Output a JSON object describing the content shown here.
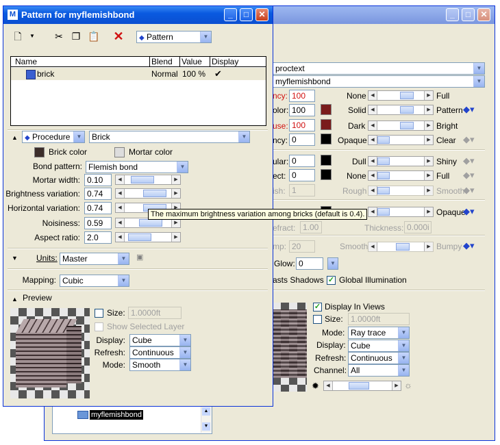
{
  "main_window": {
    "row_proctext": "proctext",
    "row_name": "myflemishbond",
    "rows": [
      {
        "label": "ncy:",
        "value": "100",
        "left": "None",
        "right": "Full"
      },
      {
        "label": "olor:",
        "value": "100",
        "left": "Solid",
        "right": "Pattern"
      },
      {
        "label": "use:",
        "value": "100",
        "left": "Dark",
        "right": "Bright"
      },
      {
        "label": "ncy:",
        "value": "0",
        "left": "Opaque",
        "right": "Clear"
      },
      {
        "label": "ular:",
        "value": "0",
        "left": "Dull",
        "right": "Shiny"
      },
      {
        "label": "ect:",
        "value": "0",
        "left": "None",
        "right": "Full"
      },
      {
        "label": "ish:",
        "value": "1",
        "left": "Rough",
        "right": "Smooth"
      },
      {
        "label": "",
        "value": "",
        "left": "",
        "right": "Opaque"
      }
    ],
    "refract_label": "efract:",
    "refract_value": "1.00",
    "thickness_label": "Thickness:",
    "thickness_value": "0.000i",
    "bump_label": "mp:",
    "bump_value": "20",
    "bump_left": "Smooth",
    "bump_right": "Bumpy",
    "glow_label": "Glow:",
    "glow_value": "0",
    "casts_shadows": "asts Shadows",
    "global_illumination": "Global Illumination",
    "display_in_views": "Display In Views",
    "size_label": "Size:",
    "size_value": "1.0000ft",
    "mode_label": "Mode:",
    "mode_value": "Ray trace",
    "display_label": "Display:",
    "display_value": "Cube",
    "refresh_label": "Refresh:",
    "refresh_value": "Continuous",
    "channel_label": "Channel:",
    "channel_value": "All",
    "tree_item": "myflemishbond"
  },
  "pattern_window": {
    "title": "Pattern for myflemishbond",
    "toolbar_dropdown": "Pattern",
    "table": {
      "headers": [
        "Name",
        "Blend",
        "Value",
        "Display"
      ],
      "rows": [
        {
          "name": "brick",
          "blend": "Normal",
          "value": "100 %",
          "display": "✔"
        }
      ]
    },
    "procedure_dropdown": "Procedure",
    "brick_dropdown": "Brick",
    "brick_color": "Brick color",
    "mortar_color": "Mortar color",
    "bond_pattern_label": "Bond pattern:",
    "bond_pattern_value": "Flemish bond",
    "params": [
      {
        "label": "Mortar width:",
        "value": "0.10"
      },
      {
        "label": "Brightness variation:",
        "value": "0.74"
      },
      {
        "label": "Horizontal variation:",
        "value": "0.74"
      },
      {
        "label": "Noisiness:",
        "value": "0.59"
      },
      {
        "label": "Aspect ratio:",
        "value": "2.0"
      }
    ],
    "units_label": "Units:",
    "units_value": "Master",
    "mapping_label": "Mapping:",
    "mapping_value": "Cubic",
    "preview_label": "Preview",
    "size_label": "Size:",
    "size_value": "1.0000ft",
    "show_selected_layer": "Show Selected Layer",
    "display_label": "Display:",
    "display_value": "Cube",
    "refresh_label": "Refresh:",
    "refresh_value": "Continuous",
    "mode_label": "Mode:",
    "mode_value": "Smooth"
  },
  "tooltip": "The maximum brightness variation among bricks (default is 0.4).",
  "colors": {
    "brick": "#3c2e2a",
    "mortar": "#dddddd",
    "selected_row": "#ebe8d5",
    "red_value": "#d01010"
  }
}
